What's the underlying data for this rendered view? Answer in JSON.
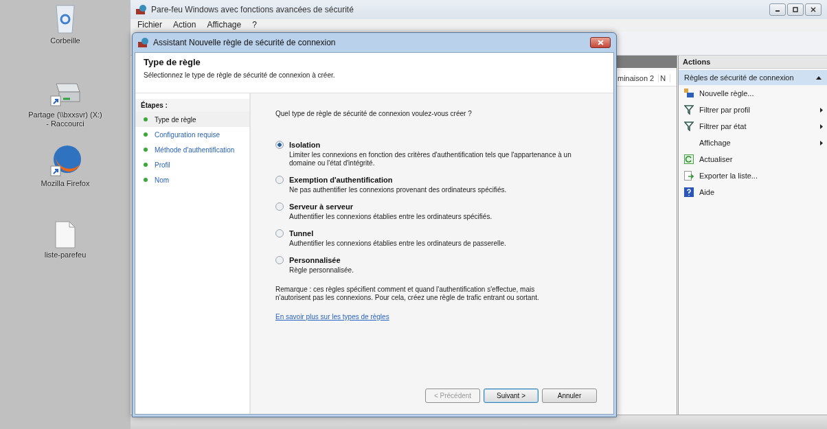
{
  "desktop_icons": [
    {
      "kind": "recycle",
      "label": "Corbeille"
    },
    {
      "kind": "drive",
      "label": "Partage (\\\\bxxsvr) (X:) - Raccourci"
    },
    {
      "kind": "browser",
      "label": "Mozilla Firefox"
    },
    {
      "kind": "file",
      "label": "liste-parefeu"
    }
  ],
  "main_window": {
    "title": "Pare-feu Windows avec fonctions avancées de sécurité",
    "menu": [
      "Fichier",
      "Action",
      "Affichage",
      "?"
    ],
    "columns": [
      "minaison 2",
      "N"
    ],
    "actions": {
      "header": "Actions",
      "section": "Règles de sécurité de connexion",
      "items": [
        {
          "kind": "new",
          "label": "Nouvelle règle...",
          "submenu": false
        },
        {
          "kind": "filter",
          "label": "Filtrer par profil",
          "submenu": true
        },
        {
          "kind": "filter",
          "label": "Filtrer par état",
          "submenu": true
        },
        {
          "kind": "none",
          "label": "Affichage",
          "submenu": true
        },
        {
          "kind": "refresh",
          "label": "Actualiser",
          "submenu": false
        },
        {
          "kind": "export",
          "label": "Exporter la liste...",
          "submenu": false
        },
        {
          "kind": "help",
          "label": "Aide",
          "submenu": false
        }
      ]
    }
  },
  "dialog": {
    "title": "Assistant Nouvelle règle de sécurité de connexion",
    "heading": "Type de règle",
    "subtitle": "Sélectionnez le type de règle de sécurité de connexion à créer.",
    "steps_heading": "Étapes :",
    "steps": [
      {
        "label": "Type de règle",
        "selected": true
      },
      {
        "label": "Configuration requise",
        "selected": false
      },
      {
        "label": "Méthode d'authentification",
        "selected": false
      },
      {
        "label": "Profil",
        "selected": false
      },
      {
        "label": "Nom",
        "selected": false
      }
    ],
    "question": "Quel type de règle de sécurité de connexion voulez-vous créer ?",
    "options": [
      {
        "label": "Isolation",
        "description": "Limiter les connexions en fonction des critères d'authentification tels que l'appartenance à un domaine ou l'état d'intégrité.",
        "selected": true
      },
      {
        "label": "Exemption d'authentification",
        "description": "Ne pas authentifier les connexions provenant des ordinateurs spécifiés.",
        "selected": false
      },
      {
        "label": "Serveur à serveur",
        "description": "Authentifier les connexions établies entre les ordinateurs spécifiés.",
        "selected": false
      },
      {
        "label": "Tunnel",
        "description": "Authentifier les connexions établies entre les ordinateurs de passerelle.",
        "selected": false
      },
      {
        "label": "Personnalisée",
        "description": "Règle personnalisée.",
        "selected": false
      }
    ],
    "note": "Remarque : ces règles spécifient comment et quand l'authentification s'effectue, mais n'autorisent pas les connexions. Pour cela, créez une règle de trafic entrant ou sortant.",
    "link": "En savoir plus sur les types de règles",
    "buttons": [
      {
        "label": "< Précédent",
        "disabled": true,
        "default": false
      },
      {
        "label": "Suivant >",
        "disabled": false,
        "default": true
      },
      {
        "label": "Annuler",
        "disabled": false,
        "default": false
      }
    ]
  }
}
